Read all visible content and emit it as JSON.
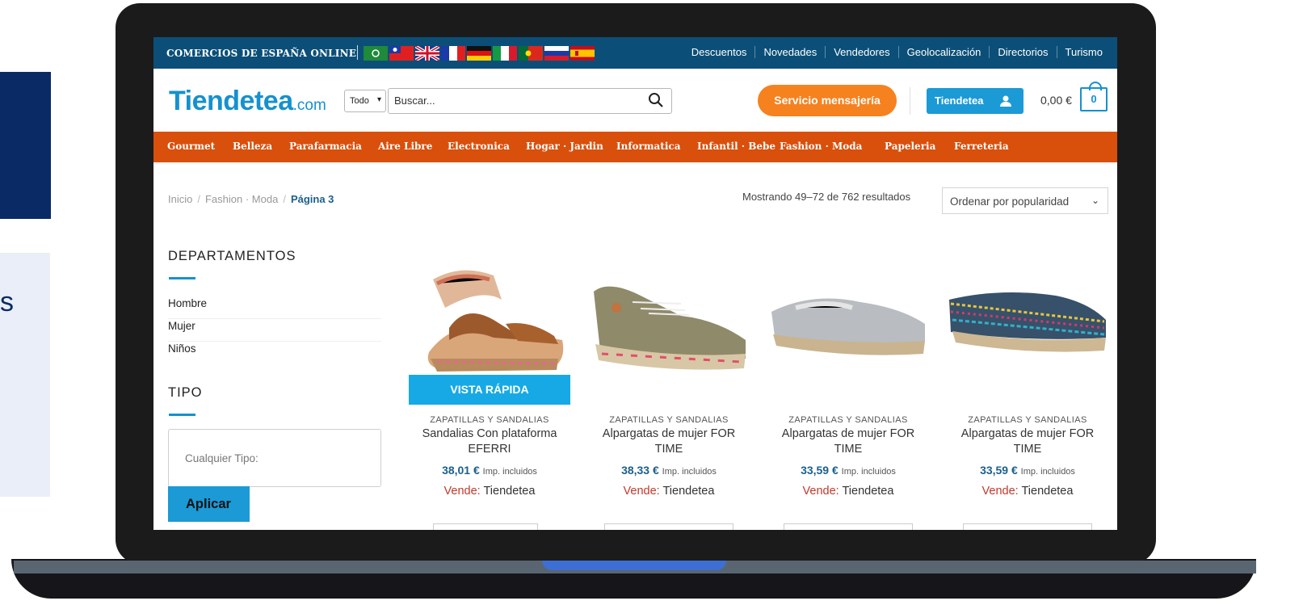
{
  "side_fragment": {
    "text": "s"
  },
  "topbar": {
    "brand": "COMERCIOS DE ESPAÑA ONLINE",
    "links": [
      "Descuentos",
      "Novedades",
      "Vendedores",
      "Geolocalización",
      "Directorios",
      "Turismo"
    ]
  },
  "header": {
    "logo_main": "Tiendetea",
    "logo_suffix": ".com",
    "category_select": "Todo",
    "search_placeholder": "Buscar...",
    "courier_button": "Servicio mensajería",
    "account_button": "Tiendetea",
    "cart_total": "0,00 €",
    "cart_count": "0"
  },
  "nav": [
    "Gourmet",
    "Belleza",
    "Parafarmacia",
    "Aire Libre",
    "Electronica",
    "Hogar · Jardin",
    "Informatica",
    "Infantil · Bebe",
    "Fashion · Moda",
    "Papeleria",
    "Ferreteria"
  ],
  "breadcrumb": {
    "home": "Inicio",
    "section": "Fashion · Moda",
    "current": "Página 3"
  },
  "results_text": "Mostrando 49–72 de 762 resultados",
  "sort_select": "Ordenar por popularidad",
  "sidebar": {
    "departments_title": "DEPARTAMENTOS",
    "departments": [
      "Hombre",
      "Mujer",
      "Niños"
    ],
    "type_title": "TIPO",
    "type_placeholder": "Cualquier Tipo:",
    "apply_button": "Aplicar"
  },
  "quick_view": "VISTA RÁPIDA",
  "products": [
    {
      "category": "ZAPATILLAS Y SANDALIAS",
      "title": "Sandalias Con plataforma EFERRI",
      "price": "38,01 €",
      "tax": "Imp. incluidos",
      "seller_label": "Vende:",
      "seller": "Tiendetea"
    },
    {
      "category": "ZAPATILLAS Y SANDALIAS",
      "title": "Alpargatas de mujer FOR TIME",
      "price": "38,33 €",
      "tax": "Imp. incluidos",
      "seller_label": "Vende:",
      "seller": "Tiendetea"
    },
    {
      "category": "ZAPATILLAS Y SANDALIAS",
      "title": "Alpargatas de mujer FOR TIME",
      "price": "33,59 €",
      "tax": "Imp. incluidos",
      "seller_label": "Vende:",
      "seller": "Tiendetea"
    },
    {
      "category": "ZAPATILLAS Y SANDALIAS",
      "title": "Alpargatas de mujer FOR TIME",
      "price": "33,59 €",
      "tax": "Imp. incluidos",
      "seller_label": "Vende:",
      "seller": "Tiendetea"
    }
  ],
  "colors": {
    "topbar": "#0b4f78",
    "nav": "#d94f0c",
    "accent_blue": "#1b9ad6",
    "orange_button": "#f5821f",
    "price_blue": "#1b5f8c",
    "seller_red": "#c0392b"
  },
  "icons": [
    "search-icon",
    "user-icon",
    "cart-icon",
    "chevron-down-icon",
    "flag-icons"
  ]
}
